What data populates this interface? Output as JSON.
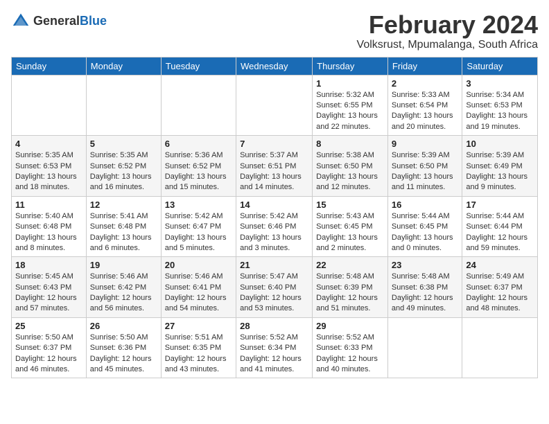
{
  "header": {
    "logo_general": "General",
    "logo_blue": "Blue",
    "month_title": "February 2024",
    "subtitle": "Volksrust, Mpumalanga, South Africa"
  },
  "weekdays": [
    "Sunday",
    "Monday",
    "Tuesday",
    "Wednesday",
    "Thursday",
    "Friday",
    "Saturday"
  ],
  "weeks": [
    [
      {
        "day": "",
        "info": ""
      },
      {
        "day": "",
        "info": ""
      },
      {
        "day": "",
        "info": ""
      },
      {
        "day": "",
        "info": ""
      },
      {
        "day": "1",
        "info": "Sunrise: 5:32 AM\nSunset: 6:55 PM\nDaylight: 13 hours\nand 22 minutes."
      },
      {
        "day": "2",
        "info": "Sunrise: 5:33 AM\nSunset: 6:54 PM\nDaylight: 13 hours\nand 20 minutes."
      },
      {
        "day": "3",
        "info": "Sunrise: 5:34 AM\nSunset: 6:53 PM\nDaylight: 13 hours\nand 19 minutes."
      }
    ],
    [
      {
        "day": "4",
        "info": "Sunrise: 5:35 AM\nSunset: 6:53 PM\nDaylight: 13 hours\nand 18 minutes."
      },
      {
        "day": "5",
        "info": "Sunrise: 5:35 AM\nSunset: 6:52 PM\nDaylight: 13 hours\nand 16 minutes."
      },
      {
        "day": "6",
        "info": "Sunrise: 5:36 AM\nSunset: 6:52 PM\nDaylight: 13 hours\nand 15 minutes."
      },
      {
        "day": "7",
        "info": "Sunrise: 5:37 AM\nSunset: 6:51 PM\nDaylight: 13 hours\nand 14 minutes."
      },
      {
        "day": "8",
        "info": "Sunrise: 5:38 AM\nSunset: 6:50 PM\nDaylight: 13 hours\nand 12 minutes."
      },
      {
        "day": "9",
        "info": "Sunrise: 5:39 AM\nSunset: 6:50 PM\nDaylight: 13 hours\nand 11 minutes."
      },
      {
        "day": "10",
        "info": "Sunrise: 5:39 AM\nSunset: 6:49 PM\nDaylight: 13 hours\nand 9 minutes."
      }
    ],
    [
      {
        "day": "11",
        "info": "Sunrise: 5:40 AM\nSunset: 6:48 PM\nDaylight: 13 hours\nand 8 minutes."
      },
      {
        "day": "12",
        "info": "Sunrise: 5:41 AM\nSunset: 6:48 PM\nDaylight: 13 hours\nand 6 minutes."
      },
      {
        "day": "13",
        "info": "Sunrise: 5:42 AM\nSunset: 6:47 PM\nDaylight: 13 hours\nand 5 minutes."
      },
      {
        "day": "14",
        "info": "Sunrise: 5:42 AM\nSunset: 6:46 PM\nDaylight: 13 hours\nand 3 minutes."
      },
      {
        "day": "15",
        "info": "Sunrise: 5:43 AM\nSunset: 6:45 PM\nDaylight: 13 hours\nand 2 minutes."
      },
      {
        "day": "16",
        "info": "Sunrise: 5:44 AM\nSunset: 6:45 PM\nDaylight: 13 hours\nand 0 minutes."
      },
      {
        "day": "17",
        "info": "Sunrise: 5:44 AM\nSunset: 6:44 PM\nDaylight: 12 hours\nand 59 minutes."
      }
    ],
    [
      {
        "day": "18",
        "info": "Sunrise: 5:45 AM\nSunset: 6:43 PM\nDaylight: 12 hours\nand 57 minutes."
      },
      {
        "day": "19",
        "info": "Sunrise: 5:46 AM\nSunset: 6:42 PM\nDaylight: 12 hours\nand 56 minutes."
      },
      {
        "day": "20",
        "info": "Sunrise: 5:46 AM\nSunset: 6:41 PM\nDaylight: 12 hours\nand 54 minutes."
      },
      {
        "day": "21",
        "info": "Sunrise: 5:47 AM\nSunset: 6:40 PM\nDaylight: 12 hours\nand 53 minutes."
      },
      {
        "day": "22",
        "info": "Sunrise: 5:48 AM\nSunset: 6:39 PM\nDaylight: 12 hours\nand 51 minutes."
      },
      {
        "day": "23",
        "info": "Sunrise: 5:48 AM\nSunset: 6:38 PM\nDaylight: 12 hours\nand 49 minutes."
      },
      {
        "day": "24",
        "info": "Sunrise: 5:49 AM\nSunset: 6:37 PM\nDaylight: 12 hours\nand 48 minutes."
      }
    ],
    [
      {
        "day": "25",
        "info": "Sunrise: 5:50 AM\nSunset: 6:37 PM\nDaylight: 12 hours\nand 46 minutes."
      },
      {
        "day": "26",
        "info": "Sunrise: 5:50 AM\nSunset: 6:36 PM\nDaylight: 12 hours\nand 45 minutes."
      },
      {
        "day": "27",
        "info": "Sunrise: 5:51 AM\nSunset: 6:35 PM\nDaylight: 12 hours\nand 43 minutes."
      },
      {
        "day": "28",
        "info": "Sunrise: 5:52 AM\nSunset: 6:34 PM\nDaylight: 12 hours\nand 41 minutes."
      },
      {
        "day": "29",
        "info": "Sunrise: 5:52 AM\nSunset: 6:33 PM\nDaylight: 12 hours\nand 40 minutes."
      },
      {
        "day": "",
        "info": ""
      },
      {
        "day": "",
        "info": ""
      }
    ]
  ]
}
